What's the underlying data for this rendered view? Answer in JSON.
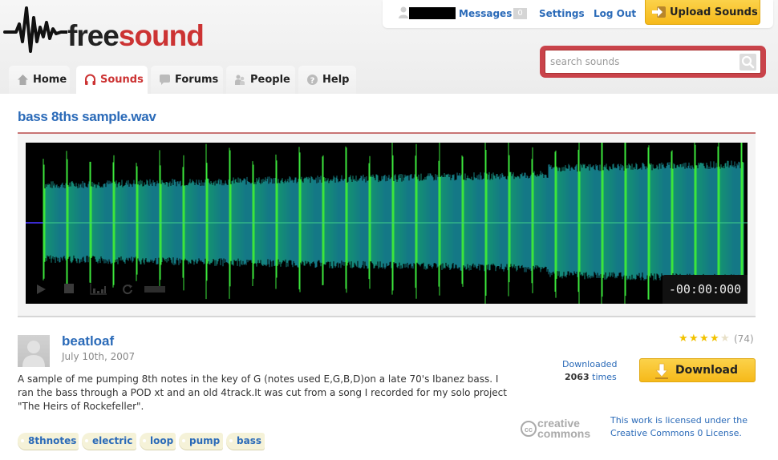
{
  "header": {
    "logo": {
      "part1": "free",
      "part2": "sound"
    },
    "user_bar": {
      "messages_label": "Messages",
      "messages_count": "0",
      "settings_label": "Settings",
      "logout_label": "Log Out",
      "upload_label": "Upload Sounds"
    },
    "search": {
      "placeholder": "search sounds",
      "value": ""
    },
    "nav": {
      "tabs": [
        {
          "label": "Home",
          "icon": "home-icon",
          "active": false
        },
        {
          "label": "Sounds",
          "icon": "headphones-icon",
          "active": true
        },
        {
          "label": "Forums",
          "icon": "speech-bubble-icon",
          "active": false
        },
        {
          "label": "People",
          "icon": "people-icon",
          "active": false
        },
        {
          "label": "Help",
          "icon": "question-icon",
          "active": false
        }
      ]
    }
  },
  "sound": {
    "title": "bass 8ths sample.wav",
    "player": {
      "time_display": "-00:00:000",
      "controls": [
        "play-icon",
        "stop-icon",
        "spectrum-icon",
        "loop-icon",
        "measure-icon"
      ]
    },
    "author": "beatloaf",
    "date": "July 10th, 2007",
    "description": "A sample of me pumping 8th notes in the key of G (notes used E,G,B,D)on a late 70's Ibanez bass. I ran the bass through a POD xt and an old 4track.It was cut from a song I recorded for my solo project \"The Heirs of Rockefeller\".",
    "tags": [
      "8thnotes",
      "electric",
      "loop",
      "pump",
      "bass"
    ],
    "rating": {
      "stars": 4,
      "max": 5,
      "count_label": "(74)"
    },
    "downloads": {
      "label": "Downloaded",
      "count": "2063",
      "suffix": "times"
    },
    "download_label": "Download",
    "license": {
      "logo_top": "creative",
      "logo_bottom": "commons",
      "text": "This work is licensed under the Creative Commons 0 License."
    }
  },
  "colors": {
    "link_blue": "#2a6ab8",
    "brand_red": "#cc3333",
    "button_yellow": "#f6b91a",
    "waveform_bg": "#000000"
  }
}
